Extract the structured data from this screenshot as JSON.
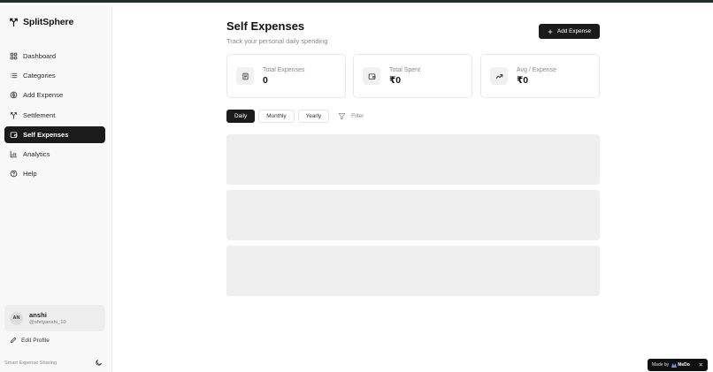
{
  "brand": {
    "name": "SplitSphere"
  },
  "sidebar": {
    "items": [
      {
        "label": "Dashboard",
        "icon": "dashboard-icon"
      },
      {
        "label": "Categories",
        "icon": "list-icon"
      },
      {
        "label": "Add Expense",
        "icon": "dollar-circle-icon"
      },
      {
        "label": "Settlement",
        "icon": "split-icon"
      },
      {
        "label": "Self Expenses",
        "icon": "wallet-icon",
        "active": true
      },
      {
        "label": "Analytics",
        "icon": "bar-chart-icon"
      },
      {
        "label": "Help",
        "icon": "help-circle-icon"
      }
    ],
    "user": {
      "initials": "AN",
      "name": "anshi",
      "handle": "@shriyanshi_10"
    },
    "edit_profile_label": "Edit Profile",
    "footer_text": "Smart Expense Sharing"
  },
  "header": {
    "title": "Self Expenses",
    "subtitle": "Track your personal daily spending",
    "add_button_label": "Add Expense"
  },
  "stats": [
    {
      "label": "Total Expenses",
      "value": "0",
      "icon": "receipt-icon"
    },
    {
      "label": "Total Spent",
      "value": "₹0",
      "icon": "wallet-icon"
    },
    {
      "label": "Avg / Expense",
      "value": "₹0",
      "icon": "trending-up-icon"
    }
  ],
  "tabs": [
    {
      "label": "Daily",
      "active": true
    },
    {
      "label": "Monthly"
    },
    {
      "label": "Yearly"
    }
  ],
  "filter_label": "Filter",
  "badge": {
    "made_by": "Made by",
    "brand": "MeDo",
    "close": "✕"
  },
  "colors": {
    "accent": "#1b1b1b",
    "skeleton": "#efefef",
    "sidebar_bg": "#f8f8f8"
  }
}
